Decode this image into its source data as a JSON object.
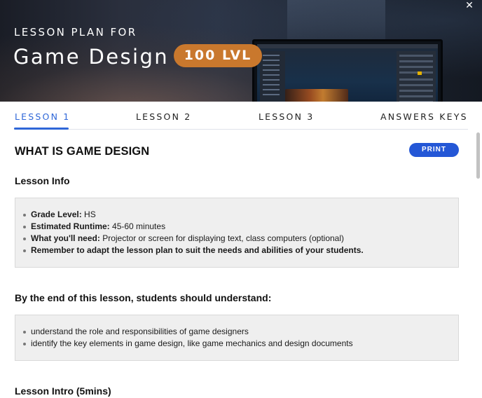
{
  "hero": {
    "subtitle": "LESSON PLAN FOR",
    "title": "Game Design",
    "badge": "100 LVL",
    "close_label": "✕"
  },
  "tabs": [
    {
      "label": "LESSON 1",
      "active": true
    },
    {
      "label": "LESSON 2",
      "active": false
    },
    {
      "label": "LESSON 3",
      "active": false
    },
    {
      "label": "ANSWERS KEYS",
      "active": false
    }
  ],
  "main": {
    "title": "WHAT IS GAME DESIGN",
    "print_label": "PRINT",
    "lesson_info": {
      "heading": "Lesson Info",
      "items": [
        {
          "label": "Grade Level:",
          "value": " HS"
        },
        {
          "label": "Estimated Runtime:",
          "value": " 45-60 minutes"
        },
        {
          "label": "What you'll need:",
          "value": " Projector or screen for displaying text, class computers (optional)"
        },
        {
          "label": "Remember to adapt the lesson plan to suit the needs and abilities of your students.",
          "value": ""
        }
      ]
    },
    "objectives": {
      "heading": "By the end of this lesson, students should understand:",
      "items": [
        "understand the role and responsibilities of game designers",
        "identify the key elements in game design, like game mechanics and design documents"
      ]
    },
    "intro": {
      "heading": "Lesson Intro (5mins)"
    }
  },
  "colors": {
    "accent": "#2f67d8",
    "print_button": "#2457d6",
    "badge": "#c9782d"
  }
}
